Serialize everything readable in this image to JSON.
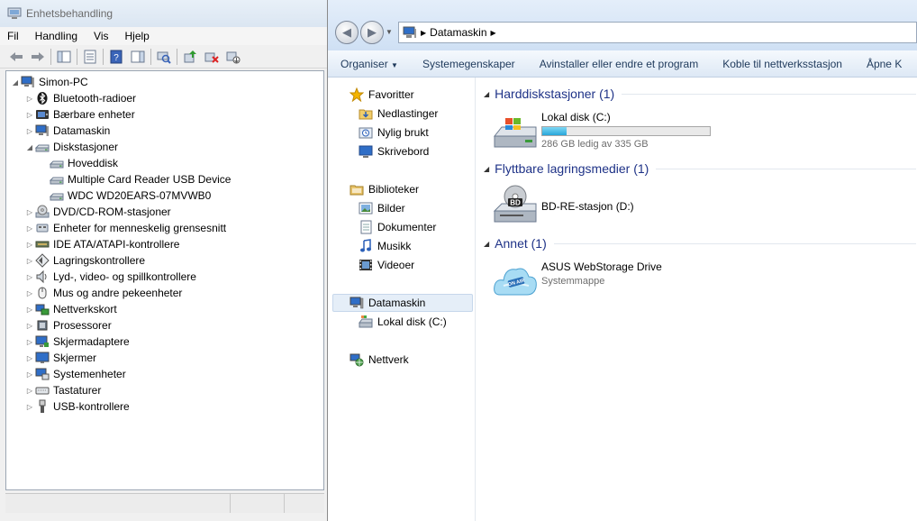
{
  "device_manager": {
    "title": "Enhetsbehandling",
    "menu": [
      "Fil",
      "Handling",
      "Vis",
      "Hjelp"
    ],
    "tree": [
      {
        "label": "Simon-PC",
        "level": 0,
        "icon": "computer-icon",
        "toggle": "expanded"
      },
      {
        "label": "Bluetooth-radioer",
        "level": 1,
        "icon": "bluetooth-icon",
        "toggle": "collapsed"
      },
      {
        "label": "Bærbare enheter",
        "level": 1,
        "icon": "portable-device-icon",
        "toggle": "collapsed"
      },
      {
        "label": "Datamaskin",
        "level": 1,
        "icon": "computer-icon",
        "toggle": "collapsed"
      },
      {
        "label": "Diskstasjoner",
        "level": 1,
        "icon": "disk-drive-icon",
        "toggle": "expanded"
      },
      {
        "label": "Hoveddisk",
        "level": 2,
        "icon": "disk-drive-icon",
        "toggle": "none"
      },
      {
        "label": "Multiple Card  Reader USB Device",
        "level": 2,
        "icon": "disk-drive-icon",
        "toggle": "none"
      },
      {
        "label": "WDC WD20EARS-07MVWB0",
        "level": 2,
        "icon": "disk-drive-icon",
        "toggle": "none"
      },
      {
        "label": "DVD/CD-ROM-stasjoner",
        "level": 1,
        "icon": "dvd-drive-icon",
        "toggle": "collapsed"
      },
      {
        "label": "Enheter for menneskelig grensesnitt",
        "level": 1,
        "icon": "hid-icon",
        "toggle": "collapsed"
      },
      {
        "label": "IDE ATA/ATAPI-kontrollere",
        "level": 1,
        "icon": "ide-controller-icon",
        "toggle": "collapsed"
      },
      {
        "label": "Lagringskontrollere",
        "level": 1,
        "icon": "storage-controller-icon",
        "toggle": "collapsed"
      },
      {
        "label": "Lyd-, video- og spillkontrollere",
        "level": 1,
        "icon": "speaker-icon",
        "toggle": "collapsed"
      },
      {
        "label": "Mus og andre pekeenheter",
        "level": 1,
        "icon": "mouse-icon",
        "toggle": "collapsed"
      },
      {
        "label": "Nettverkskort",
        "level": 1,
        "icon": "network-adapter-icon",
        "toggle": "collapsed"
      },
      {
        "label": "Prosessorer",
        "level": 1,
        "icon": "processor-icon",
        "toggle": "collapsed"
      },
      {
        "label": "Skjermadaptere",
        "level": 1,
        "icon": "display-adapter-icon",
        "toggle": "collapsed"
      },
      {
        "label": "Skjermer",
        "level": 1,
        "icon": "monitor-icon",
        "toggle": "collapsed"
      },
      {
        "label": "Systemenheter",
        "level": 1,
        "icon": "system-device-icon",
        "toggle": "collapsed"
      },
      {
        "label": "Tastaturer",
        "level": 1,
        "icon": "keyboard-icon",
        "toggle": "collapsed"
      },
      {
        "label": "USB-kontrollere",
        "level": 1,
        "icon": "usb-icon",
        "toggle": "collapsed"
      }
    ]
  },
  "explorer": {
    "breadcrumb": "Datamaskin",
    "commands": [
      "Organiser",
      "Systemegenskaper",
      "Avinstaller eller endre et program",
      "Koble til nettverksstasjon",
      "Åpne K"
    ],
    "nav": {
      "favorites": "Favoritter",
      "downloads": "Nedlastinger",
      "recent": "Nylig brukt",
      "desktop": "Skrivebord",
      "libraries": "Biblioteker",
      "pictures": "Bilder",
      "documents": "Dokumenter",
      "music": "Musikk",
      "videos": "Videoer",
      "computer": "Datamaskin",
      "local_disk": "Lokal disk (C:)",
      "network": "Nettverk"
    },
    "groups": {
      "hdd": {
        "title": "Harddiskstasjoner (1)",
        "item_name": "Lokal disk (C:)",
        "item_sub": "286 GB ledig av 335 GB",
        "used_fraction": 0.146
      },
      "removable": {
        "title": "Flyttbare lagringsmedier (1)",
        "item_name": "BD-RE-stasjon (D:)"
      },
      "other": {
        "title": "Annet (1)",
        "item_name": "ASUS WebStorage Drive",
        "item_sub": "Systemmappe"
      }
    }
  }
}
